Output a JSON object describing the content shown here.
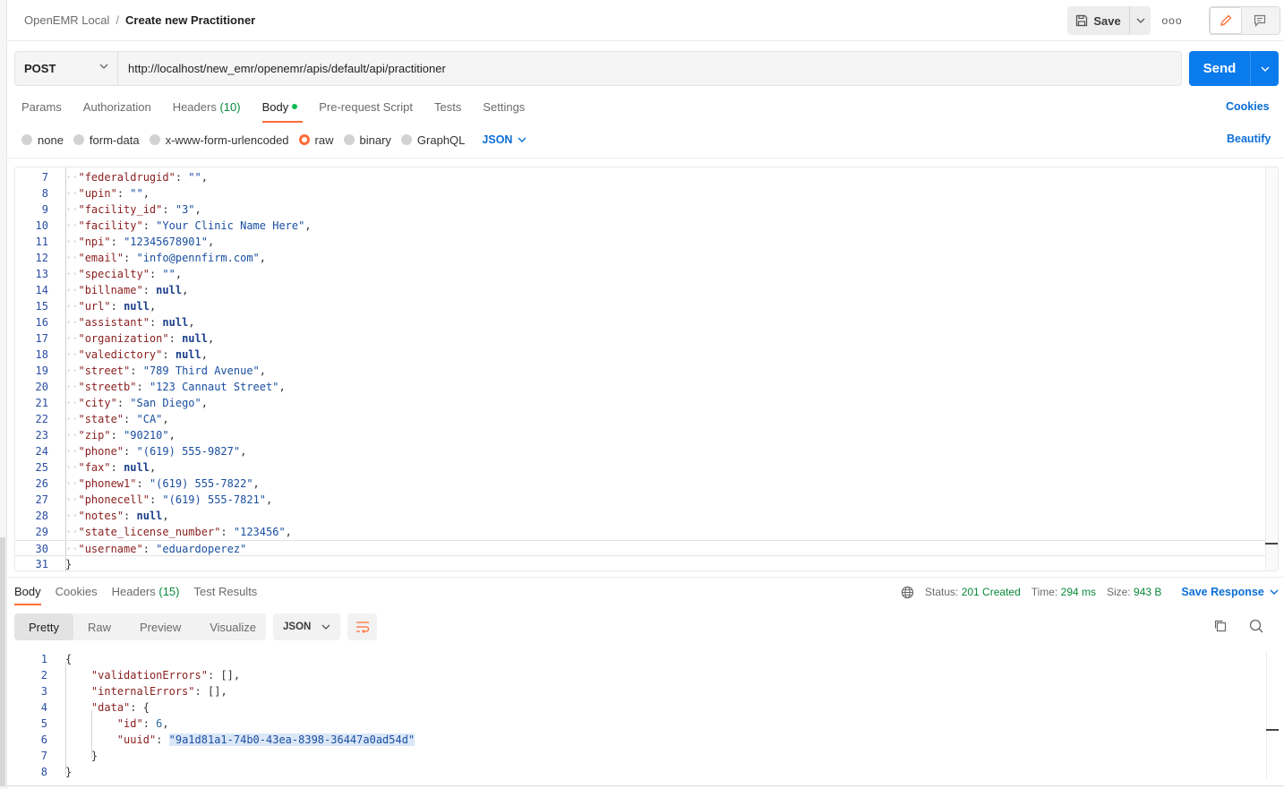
{
  "breadcrumb": {
    "workspace": "OpenEMR Local",
    "separator": "/",
    "title": "Create new Practitioner"
  },
  "toolbar": {
    "save_label": "Save",
    "more_label": "ooo"
  },
  "request": {
    "method": "POST",
    "url": "http://localhost/new_emr/openemr/apis/default/api/practitioner",
    "send_label": "Send"
  },
  "request_tabs": [
    {
      "label": "Params"
    },
    {
      "label": "Authorization"
    },
    {
      "label": "Headers",
      "count": "(10)"
    },
    {
      "label": "Body",
      "active": true
    },
    {
      "label": "Pre-request Script"
    },
    {
      "label": "Tests"
    },
    {
      "label": "Settings"
    }
  ],
  "cookies_label": "Cookies",
  "body_types": [
    "none",
    "form-data",
    "x-www-form-urlencoded",
    "raw",
    "binary",
    "GraphQL"
  ],
  "body_type_selected": "raw",
  "raw_format": "JSON",
  "beautify_label": "Beautify",
  "request_body_lines": [
    {
      "n": "7",
      "key": "federaldrugid",
      "val": "\"\"",
      "t": "s",
      "comma": true
    },
    {
      "n": "8",
      "key": "upin",
      "val": "\"\"",
      "t": "s",
      "comma": true
    },
    {
      "n": "9",
      "key": "facility_id",
      "val": "\"3\"",
      "t": "s",
      "comma": true
    },
    {
      "n": "10",
      "key": "facility",
      "val": "\"Your Clinic Name Here\"",
      "t": "s",
      "comma": true
    },
    {
      "n": "11",
      "key": "npi",
      "val": "\"12345678901\"",
      "t": "s",
      "comma": true
    },
    {
      "n": "12",
      "key": "email",
      "val": "\"info@pennfirm.com\"",
      "t": "s",
      "comma": true
    },
    {
      "n": "13",
      "key": "specialty",
      "val": "\"\"",
      "t": "s",
      "comma": true
    },
    {
      "n": "14",
      "key": "billname",
      "val": "null",
      "t": "kw",
      "comma": true
    },
    {
      "n": "15",
      "key": "url",
      "val": "null",
      "t": "kw",
      "comma": true
    },
    {
      "n": "16",
      "key": "assistant",
      "val": "null",
      "t": "kw",
      "comma": true
    },
    {
      "n": "17",
      "key": "organization",
      "val": "null",
      "t": "kw",
      "comma": true
    },
    {
      "n": "18",
      "key": "valedictory",
      "val": "null",
      "t": "kw",
      "comma": true
    },
    {
      "n": "19",
      "key": "street",
      "val": "\"789 Third Avenue\"",
      "t": "s",
      "comma": true
    },
    {
      "n": "20",
      "key": "streetb",
      "val": "\"123 Cannaut Street\"",
      "t": "s",
      "comma": true
    },
    {
      "n": "21",
      "key": "city",
      "val": "\"San Diego\"",
      "t": "s",
      "comma": true
    },
    {
      "n": "22",
      "key": "state",
      "val": "\"CA\"",
      "t": "s",
      "comma": true
    },
    {
      "n": "23",
      "key": "zip",
      "val": "\"90210\"",
      "t": "s",
      "comma": true
    },
    {
      "n": "24",
      "key": "phone",
      "val": "\"(619) 555-9827\"",
      "t": "s",
      "comma": true
    },
    {
      "n": "25",
      "key": "fax",
      "val": "null",
      "t": "kw",
      "comma": true
    },
    {
      "n": "26",
      "key": "phonew1",
      "val": "\"(619) 555-7822\"",
      "t": "s",
      "comma": true
    },
    {
      "n": "27",
      "key": "phonecell",
      "val": "\"(619) 555-7821\"",
      "t": "s",
      "comma": true
    },
    {
      "n": "28",
      "key": "notes",
      "val": "null",
      "t": "kw",
      "comma": true
    },
    {
      "n": "29",
      "key": "state_license_number",
      "val": "\"123456\"",
      "t": "s",
      "comma": true
    },
    {
      "n": "30",
      "key": "username",
      "val": "\"eduardoperez\"",
      "t": "s",
      "comma": false
    },
    {
      "n": "31",
      "raw": "}"
    }
  ],
  "response_tabs": [
    {
      "label": "Body",
      "active": true
    },
    {
      "label": "Cookies"
    },
    {
      "label": "Headers",
      "count": "(15)"
    },
    {
      "label": "Test Results"
    }
  ],
  "response_status": {
    "status_label": "Status:",
    "status_value": "201 Created",
    "time_label": "Time:",
    "time_value": "294 ms",
    "size_label": "Size:",
    "size_value": "943 B",
    "save_response_label": "Save Response"
  },
  "response_views": [
    "Pretty",
    "Raw",
    "Preview",
    "Visualize"
  ],
  "response_view_active": "Pretty",
  "response_format": "JSON",
  "response_body_lines": [
    {
      "n": "1",
      "indent": 0,
      "raw": "{"
    },
    {
      "n": "2",
      "indent": 1,
      "key": "validationErrors",
      "val": "[]",
      "t": "p",
      "comma": true
    },
    {
      "n": "3",
      "indent": 1,
      "key": "internalErrors",
      "val": "[]",
      "t": "p",
      "comma": true
    },
    {
      "n": "4",
      "indent": 1,
      "key": "data",
      "val": "{",
      "t": "p",
      "comma": false
    },
    {
      "n": "5",
      "indent": 2,
      "key": "id",
      "val": "6",
      "t": "n",
      "comma": true
    },
    {
      "n": "6",
      "indent": 2,
      "key": "uuid",
      "val": "\"9a1d81a1-74b0-43ea-8398-36447a0ad54d\"",
      "t": "s",
      "comma": false,
      "highlight": true
    },
    {
      "n": "7",
      "indent": 1,
      "raw": "}"
    },
    {
      "n": "8",
      "indent": 0,
      "raw": "}"
    }
  ],
  "colors": {
    "accent": "#ff6c37",
    "primary": "#097bed",
    "success": "#0a8a3a"
  }
}
